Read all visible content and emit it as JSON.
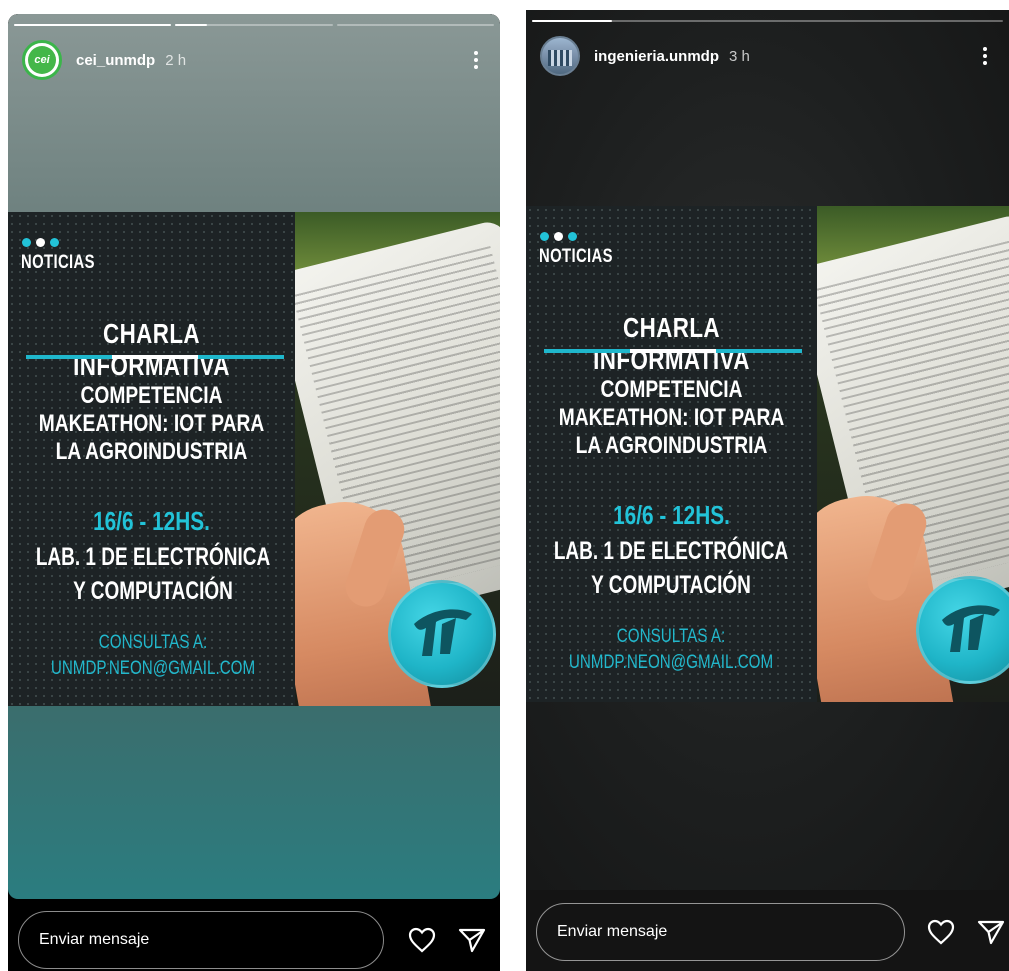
{
  "colors": {
    "accent_cyan": "#22c3d8",
    "progress_active": "#ffffff",
    "left_bg_top": "#8a9896",
    "left_bg_bottom": "#2b7d80",
    "right_bg": "#1d1f1f"
  },
  "stories": [
    {
      "username": "cei_unmdp",
      "time": "2 h",
      "avatar_text": "cei",
      "progress": [
        1.0,
        0.2,
        0.0
      ],
      "post": {
        "section": "NOTICIAS",
        "headline": "CHARLA INFORMATIVA",
        "event": "COMPETENCIA MAKEATHON: IOT PARA LA AGROINDUSTRIA",
        "date": "16/6 - 12HS.",
        "place": "LAB. 1 DE ELECTRÓNICA Y COMPUTACIÓN",
        "contact_label": "CONSULTAS A:",
        "contact_email": "UNMDP.NEON@GMAIL.COM"
      },
      "reply_placeholder": "Enviar mensaje"
    },
    {
      "username": "ingenieria.unmdp",
      "time": "3 h",
      "progress": [
        0.17
      ],
      "post": {
        "section": "NOTICIAS",
        "headline": "CHARLA INFORMATIVA",
        "event": "COMPETENCIA MAKEATHON: IOT PARA LA AGROINDUSTRIA",
        "date": "16/6 - 12HS.",
        "place": "LAB. 1 DE ELECTRÓNICA Y COMPUTACIÓN",
        "contact_label": "CONSULTAS A:",
        "contact_email": "UNMDP.NEON@GMAIL.COM"
      },
      "reply_placeholder": "Enviar mensaje"
    }
  ],
  "icons": {
    "more": "more-vertical-icon",
    "like": "heart-icon",
    "share": "send-icon"
  }
}
